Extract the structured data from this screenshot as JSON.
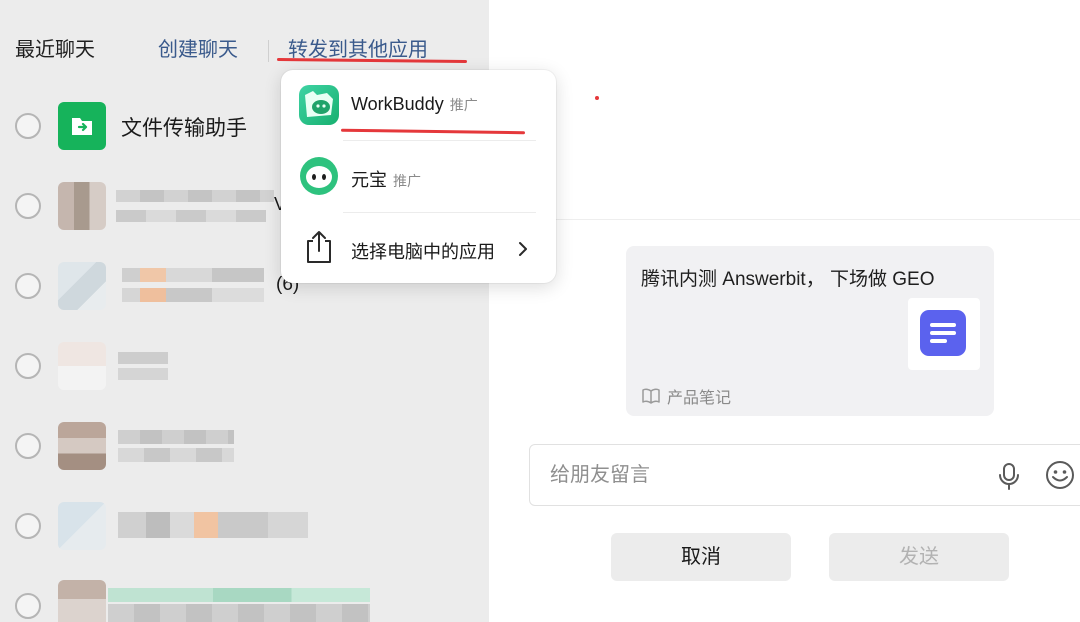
{
  "tabs": {
    "recent": "最近聊天",
    "create": "创建聊天",
    "forward": "转发到其他应用"
  },
  "chats": [
    {
      "name": "文件传输助手",
      "icon": "file-transfer-icon",
      "color": "#16b35b"
    },
    {
      "suffix": "V"
    },
    {
      "suffix": "(6)"
    }
  ],
  "popup": {
    "items": [
      {
        "label": "WorkBuddy",
        "tag": "推广",
        "icon": "workbuddy-icon"
      },
      {
        "label": "元宝",
        "tag": "推广",
        "icon": "yuanbao-icon"
      },
      {
        "label": "选择电脑中的应用",
        "icon": "share-icon",
        "chevron": "chevron-right-icon"
      }
    ]
  },
  "card": {
    "title": "腾讯内测 Answerbit， 下场做 GEO",
    "source": "产品笔记",
    "thumb_color": "#5b62ee"
  },
  "message_input": {
    "placeholder": "给朋友留言",
    "value": ""
  },
  "buttons": {
    "cancel": "取消",
    "send": "发送"
  },
  "colors": {
    "accent_link": "#3a5a8c",
    "annotation_red": "#e5383b",
    "left_bg": "#ececec"
  }
}
